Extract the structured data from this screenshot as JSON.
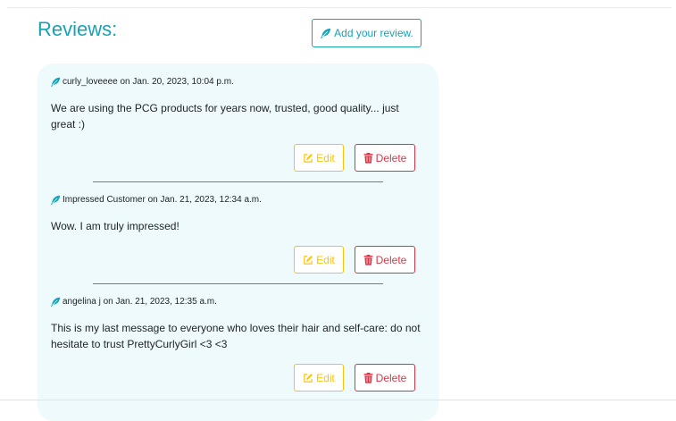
{
  "colors": {
    "accent": "#17a2b8",
    "card_background": "#eefafc",
    "edit": "#ffc107",
    "delete": "#dc3545",
    "text": "#212529"
  },
  "icons": {
    "author": "feather-icon",
    "add_review": "feather-icon",
    "edit": "edit-icon",
    "delete": "trash-icon"
  },
  "header": {
    "title": "Reviews:",
    "add_review_label": "Add your review."
  },
  "reviews": [
    {
      "author": "curly_loveeee",
      "meta_suffix": " on Jan. 20, 2023, 10:04 p.m.",
      "body": "We are using the PCG products for years now, trusted, good quality... just great :)",
      "edit_label": "Edit",
      "delete_label": "Delete"
    },
    {
      "author": "Impressed Customer",
      "meta_suffix": " on Jan. 21, 2023, 12:34 a.m.",
      "body": "Wow. I am truly impressed!",
      "edit_label": "Edit",
      "delete_label": "Delete"
    },
    {
      "author": "angelina j",
      "meta_suffix": " on Jan. 21, 2023, 12:35 a.m.",
      "body": "This is my last message to everyone who loves their hair and self-care: do not hesitate to trust PrettyCurlyGirl <3 <3",
      "edit_label": "Edit",
      "delete_label": "Delete"
    }
  ]
}
